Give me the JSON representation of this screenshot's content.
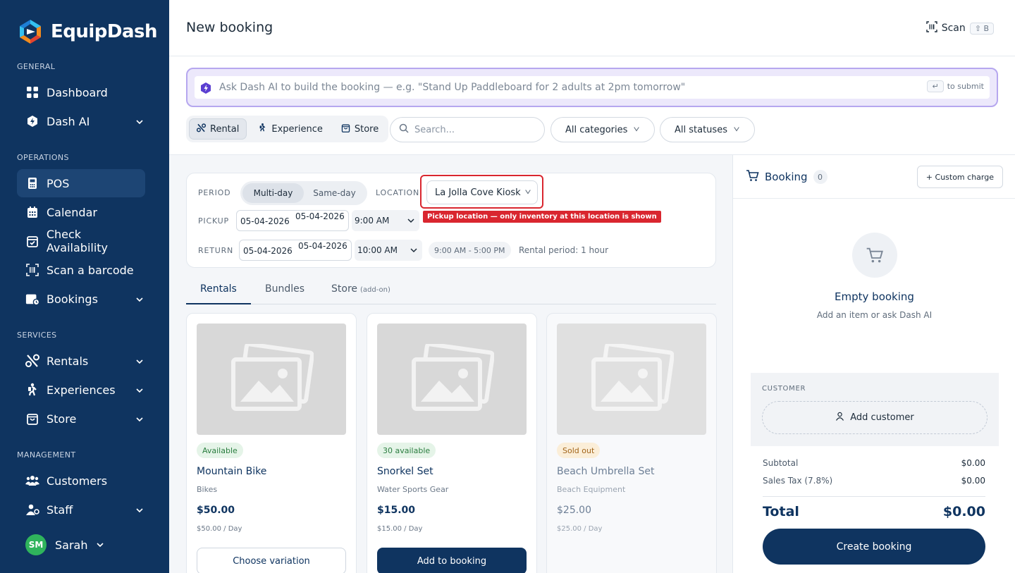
{
  "brand": {
    "name": "EquipDash"
  },
  "sidebar": {
    "sections": [
      {
        "title": "GENERAL"
      },
      {
        "title": "OPERATIONS"
      },
      {
        "title": "SERVICES"
      },
      {
        "title": "MANAGEMENT"
      }
    ],
    "items": [
      {
        "label": "Dashboard",
        "icon": "grid-icon"
      },
      {
        "label": "Dash AI",
        "icon": "ai-shield-icon",
        "expandable": true
      },
      {
        "label": "POS",
        "icon": "pos-terminal-icon",
        "active": true
      },
      {
        "label": "Calendar",
        "icon": "calendar-icon"
      },
      {
        "label": "Check Availability",
        "icon": "calendar-check-icon"
      },
      {
        "label": "Scan a barcode",
        "icon": "barcode-icon"
      },
      {
        "label": "Bookings",
        "icon": "bookings-icon",
        "expandable": true
      },
      {
        "label": "Rentals",
        "icon": "bike-icon",
        "expandable": true
      },
      {
        "label": "Experiences",
        "icon": "hiker-icon",
        "expandable": true
      },
      {
        "label": "Store",
        "icon": "shopping-bag-icon",
        "expandable": true
      },
      {
        "label": "Customers",
        "icon": "users-icon"
      },
      {
        "label": "Staff",
        "icon": "staff-icon",
        "expandable": true
      }
    ],
    "user": {
      "initials": "SM",
      "name": "Sarah"
    }
  },
  "header": {
    "title": "New booking",
    "scan_label": "Scan",
    "scan_shortcut": "⇧ B"
  },
  "ai": {
    "placeholder": "Ask Dash AI to build the booking — e.g. \"Stand Up Paddleboard for 2 adults at 2pm tomorrow\"",
    "submit_hint": "to submit"
  },
  "filters": {
    "types": [
      {
        "label": "Rental",
        "active": true
      },
      {
        "label": "Experience"
      },
      {
        "label": "Store"
      }
    ],
    "search_placeholder": "Search...",
    "categories": "All categories",
    "statuses": "All statuses"
  },
  "period": {
    "period_label": "PERIOD",
    "modes": [
      "Multi-day",
      "Same-day"
    ],
    "location_label": "LOCATION",
    "location_value": "La Jolla Cove Kiosk",
    "tooltip": "Pickup location — only inventory at this location is shown",
    "pickup_label": "PICKUP",
    "pickup_date": "05-04-2026",
    "pickup_time": "9:00 AM",
    "return_label": "RETURN",
    "return_date": "05-04-2026",
    "return_time": "10:00 AM",
    "hours": "9:00 AM - 5:00 PM",
    "rental_period": "Rental period: 1 hour"
  },
  "tabs": {
    "rentals": "Rentals",
    "bundles": "Bundles",
    "store": "Store",
    "store_addon": "(add-on)"
  },
  "products": [
    {
      "status": "Available",
      "name": "Mountain Bike",
      "category": "Bikes",
      "price": "$50.00",
      "rate": "$50.00 / Day",
      "button": "Choose variation"
    },
    {
      "status": "30 available",
      "name": "Snorkel Set",
      "category": "Water Sports Gear",
      "price": "$15.00",
      "rate": "$15.00 / Day",
      "button": "Add to booking"
    },
    {
      "status": "Sold out",
      "name": "Beach Umbrella Set",
      "category": "Beach Equipment",
      "price": "$25.00",
      "rate": "$25.00 / Day"
    }
  ],
  "booking": {
    "title": "Booking",
    "count": "0",
    "custom_charge": "+ Custom charge",
    "empty_title": "Empty booking",
    "empty_sub": "Add an item or ask Dash AI",
    "customer_label": "CUSTOMER",
    "add_customer": "Add customer",
    "subtotal_label": "Subtotal",
    "subtotal": "$0.00",
    "tax_label": "Sales Tax (7.8%)",
    "tax": "$0.00",
    "total_label": "Total",
    "total": "$0.00",
    "create": "Create booking"
  },
  "colors": {
    "sidebar": "#0f3460",
    "accent": "#0f3460",
    "ai_border": "#b6a7ef",
    "highlight": "#d9262f",
    "available": "#2a7d3f",
    "sold_out": "#a2651a"
  }
}
